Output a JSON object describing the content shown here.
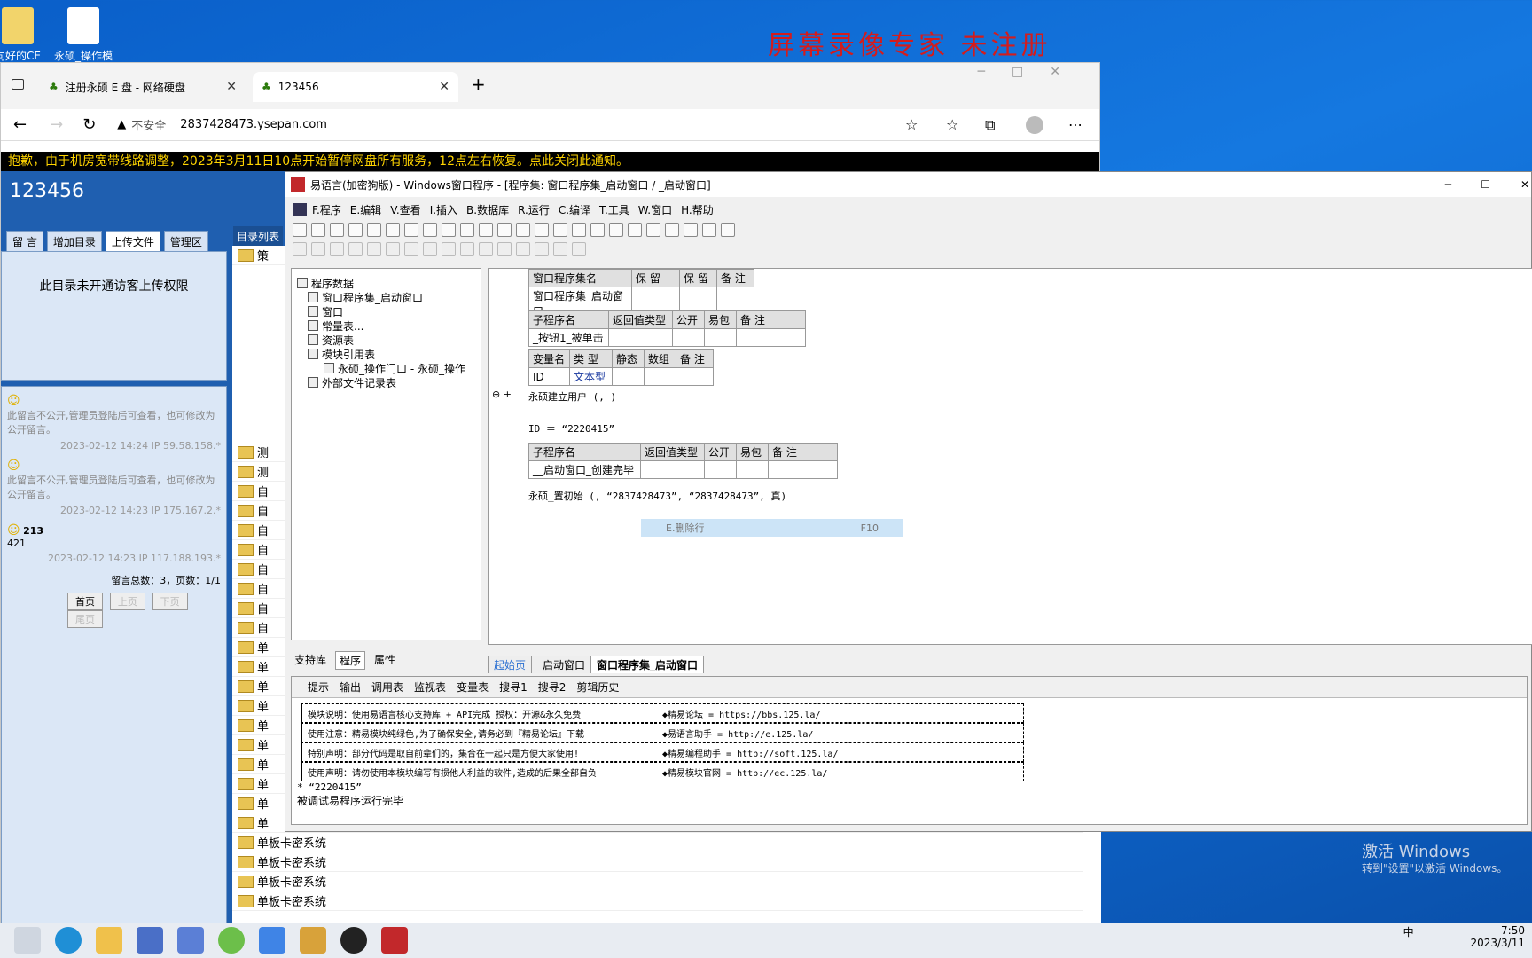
{
  "desktop": {
    "icon1_label": "向好的CE",
    "icon2_label": "永硕_操作模",
    "watermark": "屏幕录像专家 未注册",
    "activate_title": "激活 Windows",
    "activate_sub": "转到\"设置\"以激活 Windows。"
  },
  "browser": {
    "tabs": [
      {
        "title": "注册永硕 E 盘 - 网络硬盘"
      },
      {
        "title": "123456"
      }
    ],
    "new_tab": "+",
    "security": "不安全",
    "url": "2837428473.ysepan.com",
    "notice": "抱歉，由于机房宽带线路调整，2023年3月11日10点开始暂停网盘所有服务，12点左右恢复。点此关闭此通知。"
  },
  "site": {
    "title": "123456",
    "tabs": [
      "留 言",
      "增加目录",
      "上传文件",
      "管理区"
    ],
    "dir_header": "目录列表",
    "upload_msg": "此目录未开通访客上传权限",
    "messages": [
      {
        "text": "此留言不公开,管理员登陆后可查看，也可修改为公开留言。",
        "meta": "2023-02-12 14:24 IP 59.58.158.*"
      },
      {
        "text": "此留言不公开,管理员登陆后可查看，也可修改为公开留言。",
        "meta": "2023-02-12 14:23 IP 175.167.2.*"
      },
      {
        "text": "213",
        "body": "421",
        "meta": "2023-02-12 14:23 IP 117.188.193.*"
      }
    ],
    "pager": {
      "summary": "留言总数：3，页数：1/1",
      "first": "首页",
      "prev": "上页",
      "next": "下页",
      "last": "尾页"
    },
    "dir_items": [
      "策",
      "测",
      "测",
      "自",
      "自",
      "自",
      "自",
      "自",
      "自",
      "自",
      "自",
      "单",
      "单",
      "单",
      "单",
      "单",
      "单",
      "单",
      "单",
      "单",
      "单",
      "单板卡密系统",
      "单板卡密系统",
      "单板卡密系统",
      "单板卡密系统"
    ]
  },
  "ide": {
    "title": "易语言(加密狗版) - Windows窗口程序 - [程序集: 窗口程序集_启动窗口 / _启动窗口]",
    "menus": [
      "F.程序",
      "E.编辑",
      "V.查看",
      "I.插入",
      "B.数据库",
      "R.运行",
      "C.编译",
      "T.工具",
      "W.窗口",
      "H.帮助"
    ],
    "tree": {
      "root": "程序数据",
      "items": [
        "窗口程序集_启动窗口",
        "窗口",
        "常量表...",
        "资源表",
        "模块引用表",
        "永硕_操作门口 - 永硕_操作",
        "外部文件记录表"
      ]
    },
    "left_tabs": [
      "支持库",
      "程序",
      "属性"
    ],
    "editor": {
      "assembly_header": [
        "窗口程序集名",
        "保 留",
        "保 留",
        "备 注"
      ],
      "assembly_row": [
        "窗口程序集_启动窗口",
        "",
        "",
        ""
      ],
      "sub_header": [
        "子程序名",
        "返回值类型",
        "公开",
        "易包",
        "备 注"
      ],
      "sub1_row": [
        "_按钮1_被单击",
        "",
        "",
        "",
        ""
      ],
      "var_header": [
        "变量名",
        "类 型",
        "静态",
        "数组",
        "备 注"
      ],
      "var_row": [
        "ID",
        "文本型",
        "",
        "",
        ""
      ],
      "line1": "永硕建立用户 (, )",
      "line2": "ID ＝ “2220415”",
      "sub2_row": [
        "__启动窗口_创建完毕",
        "",
        "",
        "",
        ""
      ],
      "line3": "永硕_置初始 (, “2837428473”, “2837428473”, 真)",
      "ctx_label": "E.删除行",
      "ctx_key": "F10"
    },
    "editor_tabs": [
      "起始页",
      "_启动窗口",
      "窗口程序集_启动窗口"
    ],
    "bottom_tabs": [
      "提示",
      "输出",
      "调用表",
      "监视表",
      "变量表",
      "搜寻1",
      "搜寻2",
      "剪辑历史"
    ],
    "output": [
      {
        "left": "模块说明：使用易语言核心支持库 + API完成     授权：开源&永久免费",
        "right": "◆精易论坛      = https://bbs.125.la/"
      },
      {
        "left": "使用注意：精易模块纯绿色,为了确保安全,请务必到『精易论坛』下载",
        "right": "◆易语言助手    = http://e.125.la/"
      },
      {
        "left": "特别声明：部分代码是取自前辈们的，集合在一起只是方便大家使用!",
        "right": "◆精易编程助手  = http://soft.125.la/"
      },
      {
        "left": "使用声明：请勿使用本模块编写有损他人利益的软件,造成的后果全部自负",
        "right": "◆精易模块官网  = http://ec.125.la/"
      }
    ],
    "output_tail1": "* “2220415”",
    "output_tail2": "被调试易程序运行完毕"
  },
  "taskbar": {
    "time": "7:50",
    "date": "2023/3/11",
    "ime": "中"
  }
}
